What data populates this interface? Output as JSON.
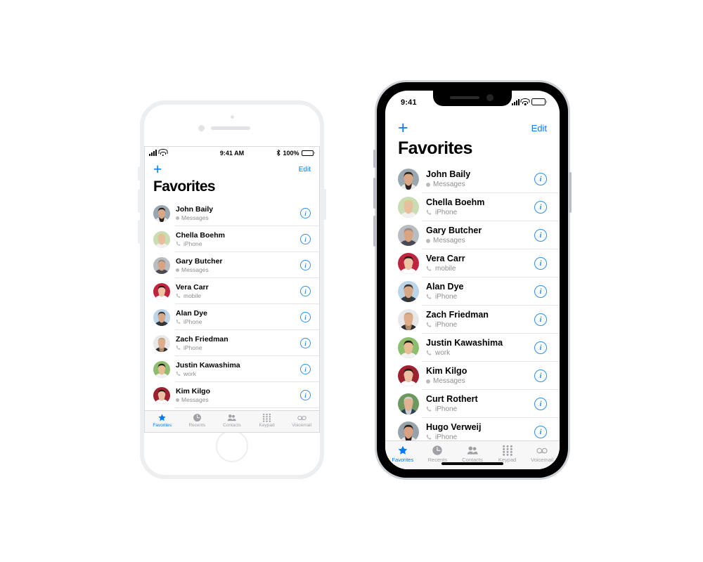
{
  "app": {
    "title": "Favorites",
    "add_label": "+",
    "edit_label": "Edit",
    "accent_color": "#007aff",
    "info_color": "#2f8ef0",
    "subtitle_color": "#8e8e93"
  },
  "status_bar_left_phone": {
    "time": "9:41 AM",
    "battery_percent": "100%",
    "signal_icon": "cellular-bars-icon",
    "wifi_icon": "wifi-icon",
    "bluetooth_icon": "bluetooth-icon",
    "battery_icon": "battery-icon"
  },
  "status_bar_right_phone": {
    "time": "9:41",
    "signal_icon": "cellular-bars-icon",
    "wifi_icon": "wifi-icon",
    "battery_icon": "battery-icon"
  },
  "favorites": [
    {
      "name": "John Baily",
      "label": "Messages",
      "icon": "messages-dot-icon",
      "avatar": {
        "bg": "#9aa7b0",
        "hair": "#2a211c",
        "skin": "#d9a887",
        "beard": "#2a211c",
        "shirt": "#e8e8e8"
      }
    },
    {
      "name": "Chella Boehm",
      "label": "iPhone",
      "icon": "phone-handset-icon",
      "avatar": {
        "bg": "#c9dcb4",
        "hair": "#e0c88a",
        "skin": "#e7bf9c",
        "beard": "",
        "shirt": "#f0f0f0"
      }
    },
    {
      "name": "Gary Butcher",
      "label": "Messages",
      "icon": "messages-dot-icon",
      "avatar": {
        "bg": "#b9bcc0",
        "hair": "#9a8c80",
        "skin": "#d8a482",
        "beard": "",
        "shirt": "#4a4a52"
      }
    },
    {
      "name": "Vera Carr",
      "label": "mobile",
      "icon": "phone-handset-icon",
      "avatar": {
        "bg": "#c0243f",
        "hair": "#241c18",
        "skin": "#edc3a4",
        "beard": "",
        "shirt": "#ffffff"
      }
    },
    {
      "name": "Alan Dye",
      "label": "iPhone",
      "icon": "phone-handset-icon",
      "avatar": {
        "bg": "#bcd4e8",
        "hair": "#3a3330",
        "skin": "#d7a887",
        "beard": "#3a3330",
        "shirt": "#2e3a47"
      }
    },
    {
      "name": "Zach Friedman",
      "label": "iPhone",
      "icon": "phone-handset-icon",
      "avatar": {
        "bg": "#e8e8ea",
        "hair": "#caa37e",
        "skin": "#deae8c",
        "beard": "#b08c6a",
        "shirt": "#2b2b30"
      }
    },
    {
      "name": "Justin Kawashima",
      "label": "work",
      "icon": "phone-handset-icon",
      "avatar": {
        "bg": "#8dbd6e",
        "hair": "#1e1a16",
        "skin": "#e8bd93",
        "beard": "",
        "shirt": "#f2f2f2"
      }
    },
    {
      "name": "Kim Kilgo",
      "label": "Messages",
      "icon": "messages-dot-icon",
      "avatar": {
        "bg": "#9e2130",
        "hair": "#241b17",
        "skin": "#ecc0a2",
        "beard": "",
        "shirt": "#ffffff"
      }
    },
    {
      "name": "Curt Rothert",
      "label": "iPhone",
      "icon": "phone-handset-icon",
      "avatar": {
        "bg": "#6d9960",
        "hair": "#cfcfcf",
        "skin": "#e0b492",
        "beard": "#cfcfcf",
        "shirt": "#2d4154"
      }
    },
    {
      "name": "Hugo Verweij",
      "label": "iPhone",
      "icon": "phone-handset-icon",
      "avatar": {
        "bg": "#97a3ab",
        "hair": "#241d19",
        "skin": "#d9a182",
        "beard": "#241d19",
        "shirt": "#e6e6e6"
      }
    }
  ],
  "tabs": [
    {
      "label": "Favorites",
      "icon": "star-icon",
      "active": true
    },
    {
      "label": "Recents",
      "icon": "clock-icon",
      "active": false
    },
    {
      "label": "Contacts",
      "icon": "people-icon",
      "active": false
    },
    {
      "label": "Keypad",
      "icon": "keypad-icon",
      "active": false
    },
    {
      "label": "Voicemail",
      "icon": "voicemail-icon",
      "active": false
    }
  ]
}
